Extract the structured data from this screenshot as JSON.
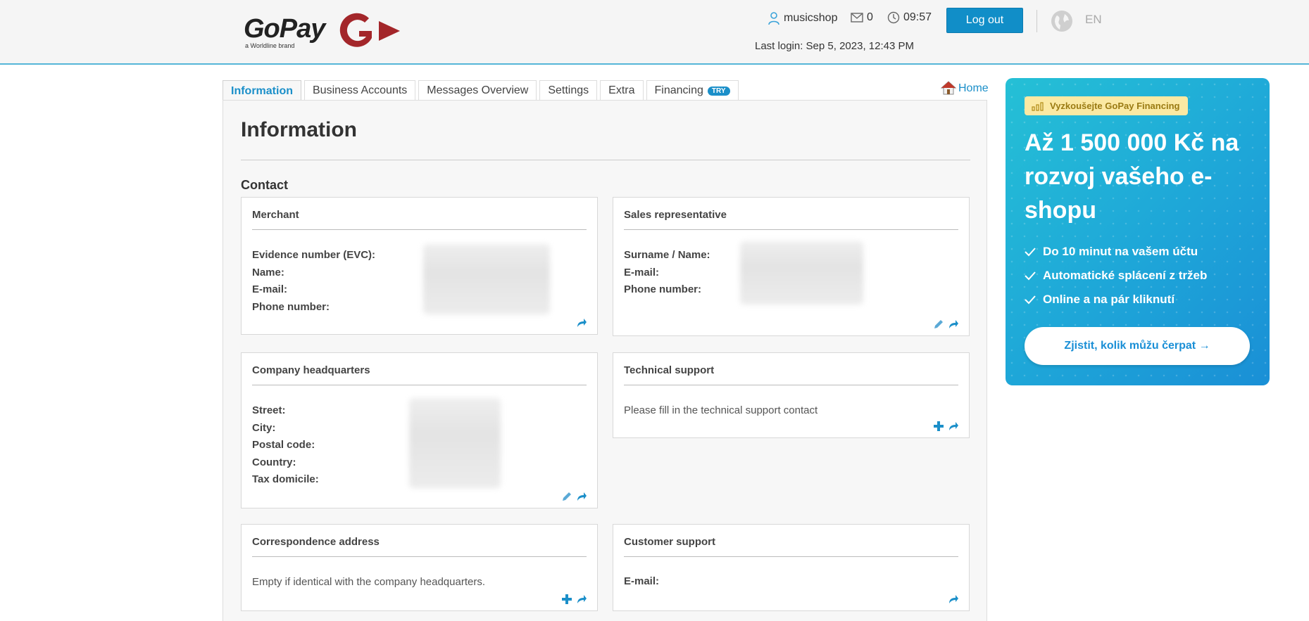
{
  "header": {
    "logo_text": "GoPay",
    "logo_sub": "a Worldline brand",
    "username": "musicshop",
    "messages_count": "0",
    "time": "09:57",
    "logout_label": "Log out",
    "language": "EN",
    "last_login": "Last login: Sep 5, 2023, 12:43 PM"
  },
  "tabs": [
    {
      "label": "Information"
    },
    {
      "label": "Business Accounts"
    },
    {
      "label": "Messages Overview"
    },
    {
      "label": "Settings"
    },
    {
      "label": "Extra"
    },
    {
      "label": "Financing",
      "badge": "TRY"
    }
  ],
  "home_label": "Home",
  "main": {
    "title": "Information",
    "section": "Contact",
    "cards": {
      "merchant": {
        "title": "Merchant",
        "rows": [
          "Evidence number (EVC):",
          "Name:",
          "E-mail:",
          "Phone number:"
        ]
      },
      "sales": {
        "title": "Sales representative",
        "rows": [
          "Surname / Name:",
          "E-mail:",
          "Phone number:"
        ]
      },
      "hq": {
        "title": "Company headquarters",
        "rows": [
          "Street:",
          "City:",
          "Postal code:",
          "Country:",
          "Tax domicile:"
        ]
      },
      "tech": {
        "title": "Technical support",
        "note": "Please fill in the technical support contact"
      },
      "corr": {
        "title": "Correspondence address",
        "note": "Empty if identical with the company headquarters."
      },
      "cust": {
        "title": "Customer support",
        "rows": [
          "E-mail:"
        ]
      }
    }
  },
  "promo": {
    "badge": "Vyzkoušejte GoPay Financing",
    "headline": "Až 1 500 000 Kč na rozvoj vašeho e-shopu",
    "bullets": [
      "Do 10 minut na vašem účtu",
      "Automatické splácení z tržeb",
      "Online a na pár kliknutí"
    ],
    "button": "Zjistit, kolik můžu čerpat →"
  },
  "colors": {
    "accent": "#1b8fc9",
    "logo_red": "#a3262a",
    "promo_blue": "#1ea6d8"
  }
}
